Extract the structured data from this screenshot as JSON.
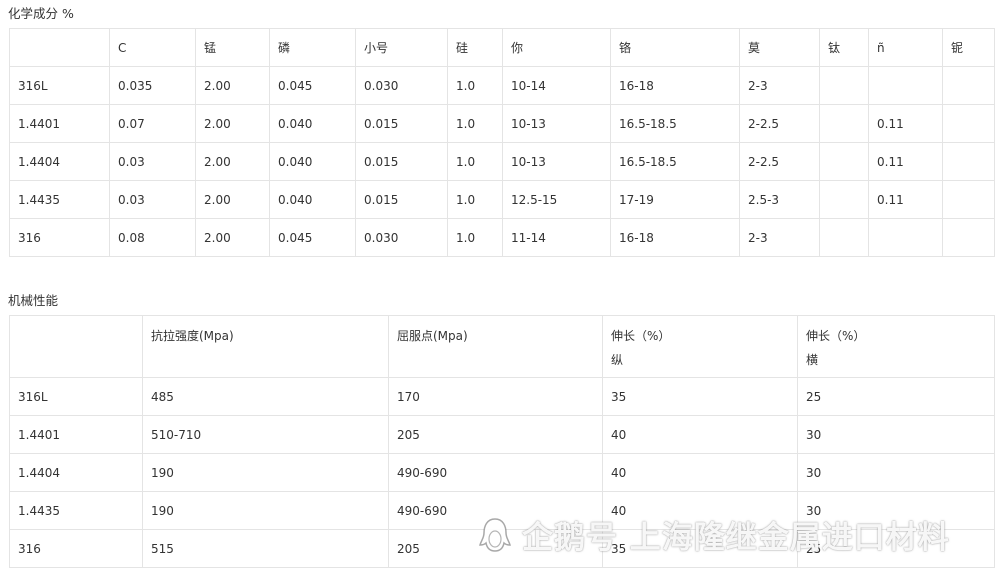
{
  "chem_section": {
    "title": "化学成分 %",
    "headers": [
      "",
      "C",
      "锰",
      "磷",
      "小号",
      "硅",
      "你",
      "铬",
      "莫",
      "钛",
      "ñ",
      "铌"
    ],
    "rows": [
      [
        "316L",
        "0.035",
        "2.00",
        "0.045",
        "0.030",
        "1.0",
        "10-14",
        "16-18",
        "2-3",
        "",
        "",
        ""
      ],
      [
        "1.4401",
        "0.07",
        "2.00",
        "0.040",
        "0.015",
        "1.0",
        "10-13",
        "16.5-18.5",
        "2-2.5",
        "",
        "0.11",
        ""
      ],
      [
        "1.4404",
        "0.03",
        "2.00",
        "0.040",
        "0.015",
        "1.0",
        "10-13",
        "16.5-18.5",
        "2-2.5",
        "",
        "0.11",
        ""
      ],
      [
        "1.4435",
        "0.03",
        "2.00",
        "0.040",
        "0.015",
        "1.0",
        "12.5-15",
        "17-19",
        "2.5-3",
        "",
        "0.11",
        ""
      ],
      [
        "316",
        "0.08",
        "2.00",
        "0.045",
        "0.030",
        "1.0",
        "11-14",
        "16-18",
        "2-3",
        "",
        "",
        ""
      ]
    ]
  },
  "mech_section": {
    "title": "机械性能",
    "headers": [
      {
        "line1": "",
        "line2": ""
      },
      {
        "line1": "抗拉强度(Mpa)",
        "line2": ""
      },
      {
        "line1": "屈服点(Mpa)",
        "line2": ""
      },
      {
        "line1": "伸长（%）",
        "line2": "纵"
      },
      {
        "line1": "伸长（%）",
        "line2": "横"
      }
    ],
    "rows": [
      [
        "316L",
        "485",
        "170",
        "35",
        "25"
      ],
      [
        "1.4401",
        "510-710",
        "205",
        "40",
        "30"
      ],
      [
        "1.4404",
        "190",
        "490-690",
        "40",
        "30"
      ],
      [
        "1.4435",
        "190",
        "490-690",
        "40",
        "30"
      ],
      [
        "316",
        "515",
        "205",
        "35",
        "25"
      ]
    ]
  },
  "watermark": {
    "icon": "penguin-logo-icon",
    "text": "企鹅号 上海隆继金属进口材料"
  }
}
